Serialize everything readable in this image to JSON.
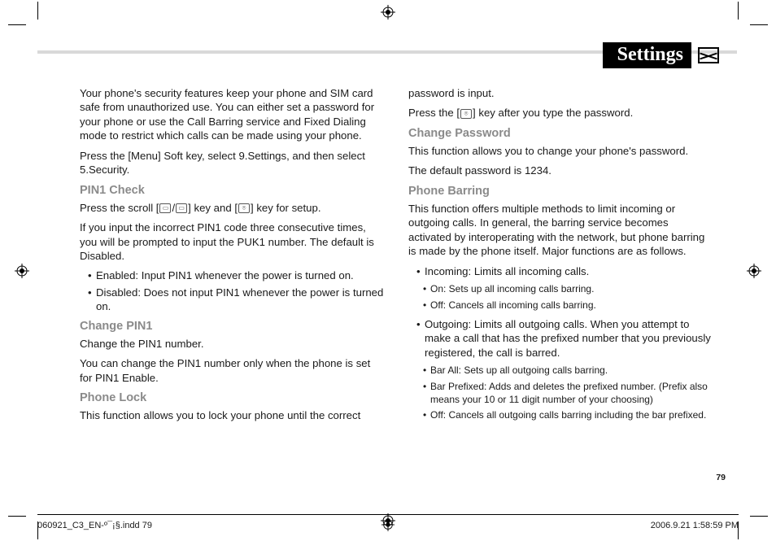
{
  "header": {
    "title": "Settings"
  },
  "page_number": "79",
  "footer": {
    "left": "060921_C3_EN-º¯¡§.indd   79",
    "right": "2006.9.21   1:58:59 PM"
  },
  "body": {
    "intro1": "Your phone's security features keep your phone and SIM card safe from unauthorized use. You can either set a password for your phone or use the Call Barring service and Fixed Dialing mode to restrict which calls can be made using your phone.",
    "intro2": "Press the [Menu] Soft key, select 9.Settings, and then select 5.Security.",
    "pin1_check": {
      "title": "PIN1 Check",
      "line1a": "Press the scroll [",
      "line1b": "] key and [",
      "line1c": "] key for setup.",
      "line2": "If you input the incorrect PIN1 code three consecutive times, you will be prompted to input the PUK1 number. The default is Disabled.",
      "bullets": [
        "Enabled: Input PIN1 whenever the power is turned on.",
        "Disabled: Does not input PIN1 whenever the power is turned on."
      ]
    },
    "change_pin1": {
      "title": "Change PIN1",
      "line1": "Change the PIN1 number.",
      "line2": "You can change the PIN1 number only when the phone is set for PIN1 Enable."
    },
    "phone_lock": {
      "title": "Phone Lock",
      "line1": "This function allows you to lock your phone until the correct",
      "line_cont": "password is input.",
      "line2a": "Press the [",
      "line2b": "] key after you type the password."
    },
    "change_password": {
      "title": "Change Password",
      "line1": "This function allows you to change your phone's password.",
      "line2": "The default password is 1234."
    },
    "phone_barring": {
      "title": "Phone Barring",
      "line1": "This function offers multiple methods to limit incoming or outgoing calls. In general, the barring service becomes activated by interoperating with the network, but phone barring is made by the phone itself. Major functions are as follows.",
      "incoming": {
        "label": "Incoming: Limits all incoming calls.",
        "sub": [
          "On: Sets up all incoming calls barring.",
          "Off: Cancels all incoming calls barring."
        ]
      },
      "outgoing": {
        "label": "Outgoing: Limits all outgoing calls. When you attempt to make a call that has the preﬁxed number that you previously registered, the call is barred.",
        "sub": [
          "Bar All: Sets up all outgoing calls barring.",
          "Bar Preﬁxed: Adds and deletes the preﬁxed number. (Preﬁx also means your 10 or 11 digit number of your choosing)",
          "Off: Cancels all outgoing calls barring including the bar preﬁxed."
        ]
      }
    }
  }
}
